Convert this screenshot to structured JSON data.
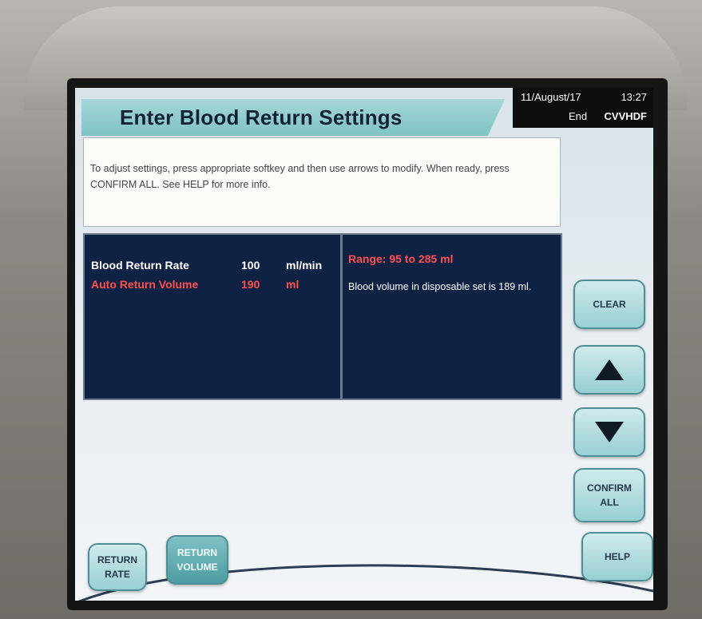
{
  "header": {
    "title": "Enter Blood Return Settings",
    "date": "11/August/17",
    "time": "13:27",
    "status": "End",
    "mode": "CVVHDF"
  },
  "instruction": {
    "text": "To adjust settings, press appropriate softkey and then use arrows to modify. When ready, press CONFIRM ALL. See HELP for more info."
  },
  "settings": {
    "rows": [
      {
        "label": "Blood Return Rate",
        "value": "100",
        "unit": "ml/min"
      },
      {
        "label": "Auto Return Volume",
        "value": "190",
        "unit": "ml"
      }
    ],
    "range": "Range: 95  to 285 ml",
    "info": "Blood volume in disposable set is 189 ml."
  },
  "softkeys": {
    "clear": "CLEAR",
    "confirm_line1": "CONFIRM",
    "confirm_line2": "ALL",
    "help": "HELP",
    "return_rate_line1": "RETURN",
    "return_rate_line2": "RATE",
    "return_volume_line1": "RETURN",
    "return_volume_line2": "VOLUME"
  },
  "colors": {
    "title_tab": "#7fc3c4",
    "settings_bg": "#0f2244",
    "highlight_red": "#ff4f4f",
    "softkey_light": "#98cfd2",
    "softkey_selected": "#4d9ca1"
  },
  "icons": {
    "up": "up-arrow-icon",
    "down": "down-arrow-icon"
  }
}
